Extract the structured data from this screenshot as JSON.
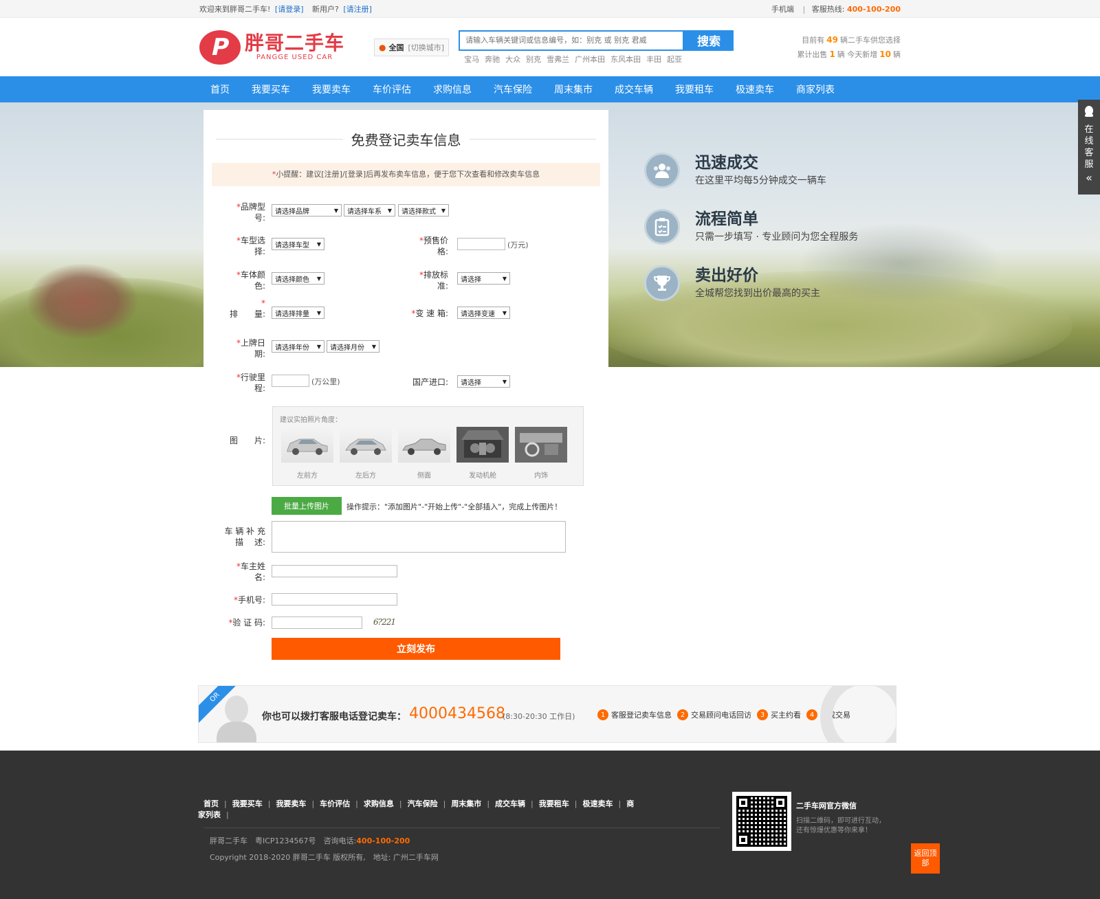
{
  "topbar": {
    "welcome": "欢迎来到胖哥二手车!",
    "login": "[请登录]",
    "new_user": "新用户?",
    "register": "[请注册]",
    "mobile": "手机端",
    "hotline_label": "客服热线:",
    "hotline": "400-100-200"
  },
  "header": {
    "logo_cn": "胖哥二手车",
    "logo_en": "PANGGE USED CAR",
    "logo_mark": "P",
    "city": "全国",
    "city_switch": "[切换城市]",
    "search_placeholder": "请输入车辆关键词或信息编号，如：别克 或 别克 君威",
    "search_button": "搜索",
    "hot_brands": [
      "宝马",
      "奔驰",
      "大众",
      "别克",
      "雪弗兰",
      "广州本田",
      "东风本田",
      "丰田",
      "起亚"
    ],
    "stats": {
      "line1_pre": "目前有",
      "line1_num": "49",
      "line1_post": "辆二手车供您选择",
      "line2_pre": "累计出售",
      "line2_num1": "1",
      "line2_mid": "辆 今天新增",
      "line2_num2": "10",
      "line2_post": "辆"
    }
  },
  "nav": [
    "首页",
    "我要买车",
    "我要卖车",
    "车价评估",
    "求购信息",
    "汽车保险",
    "周末集市",
    "成交车辆",
    "我要租车",
    "极速卖车",
    "商家列表"
  ],
  "features": [
    {
      "title": "迅速成交",
      "desc": "在这里平均每5分钟成交一辆车",
      "icon": "users-icon"
    },
    {
      "title": "流程简单",
      "desc": "只需一步填写 · 专业顾问为您全程服务",
      "icon": "clipboard-icon"
    },
    {
      "title": "卖出好价",
      "desc": "全城帮您找到出价最高的买主",
      "icon": "trophy-icon"
    }
  ],
  "form": {
    "title": "免费登记卖车信息",
    "tip_star": "*",
    "tip": "小提醒：建议[注册]/[登录]后再发布卖车信息，便于您下次查看和修改卖车信息",
    "req": "*",
    "labels": {
      "brand_1": "品牌型",
      "brand_2": "号:",
      "model_1": "车型选",
      "model_2": "择:",
      "price_1": "预售价",
      "price_2": "格:",
      "color_1": "车体颜",
      "color_2": "色:",
      "emission_1": "排放标",
      "emission_2": "准:",
      "displacement": "排　　量:",
      "gearbox": "变 速 箱:",
      "reg_1": "上牌日",
      "reg_2": "期:",
      "mileage_1": "行驶里",
      "mileage_2": "程:",
      "origin": "国产进口:",
      "photos": "图　　片:",
      "desc_1": "车 辆 补 充",
      "desc_2": "描　 述:",
      "owner_1": "车主姓",
      "owner_2": "名:",
      "phone": "手机号:",
      "captcha": "验 证 码:"
    },
    "selects": {
      "brand": "请选择品牌",
      "series": "请选择车系",
      "style": "请选择款式",
      "model": "请选择车型",
      "color": "请选择颜色",
      "emission": "请选择",
      "displacement": "请选择排量",
      "gearbox": "请选择变速",
      "reg_year": "请选择年份",
      "reg_month": "请选择月份",
      "origin": "请选择"
    },
    "units": {
      "price": "(万元)",
      "mileage": "(万公里)"
    },
    "photo_hint": "建议实拍照片角度：",
    "photo_angles": [
      "左前方",
      "左后方",
      "侧面",
      "发动机舱",
      "内饰"
    ],
    "upload_button": "批量上传图片",
    "upload_tip": "操作提示：\"添加图片\"-\"开始上传\"-\"全部插入\"，完成上传图片！",
    "captcha_code": "6?221",
    "submit": "立刻发布"
  },
  "phone_strip": {
    "corner": "OR",
    "call": "你也可以拨打客服电话登记卖车：",
    "number": "4000434568",
    "hours": "(8:30-20:30 工作日)",
    "steps": [
      "客服登记卖车信息",
      "交易顾问电话回访",
      "买主约看",
      "完成交易"
    ]
  },
  "footer": {
    "links": [
      "首页",
      "我要买车",
      "我要卖车",
      "车价评估",
      "求购信息",
      "汽车保险",
      "周末集市",
      "成交车辆",
      "我要租车",
      "极速卖车",
      "商"
    ],
    "links_wrap": "家列表",
    "info_line1_pre": "胖哥二手车　粤ICP1234567号　咨询电话:",
    "info_line1_tel": "400-100-200",
    "info_line2": "Copyright 2018-2020 胖哥二手车 版权所有,　地址: 广州二手车网",
    "qr_title": "二手车网官方微信",
    "qr_desc": "扫描二维码，即可进行互动，还有惊爆优惠等你来拿！",
    "back_top": "返回顶部"
  },
  "side_service": {
    "text": "在线客服",
    "arrow": "«"
  },
  "colors": {
    "brand_red": "#e33c47",
    "nav_blue": "#2b8fe8",
    "accent_orange": "#ff5a00",
    "upload_green": "#4caa45",
    "footer_bg": "#333333"
  }
}
